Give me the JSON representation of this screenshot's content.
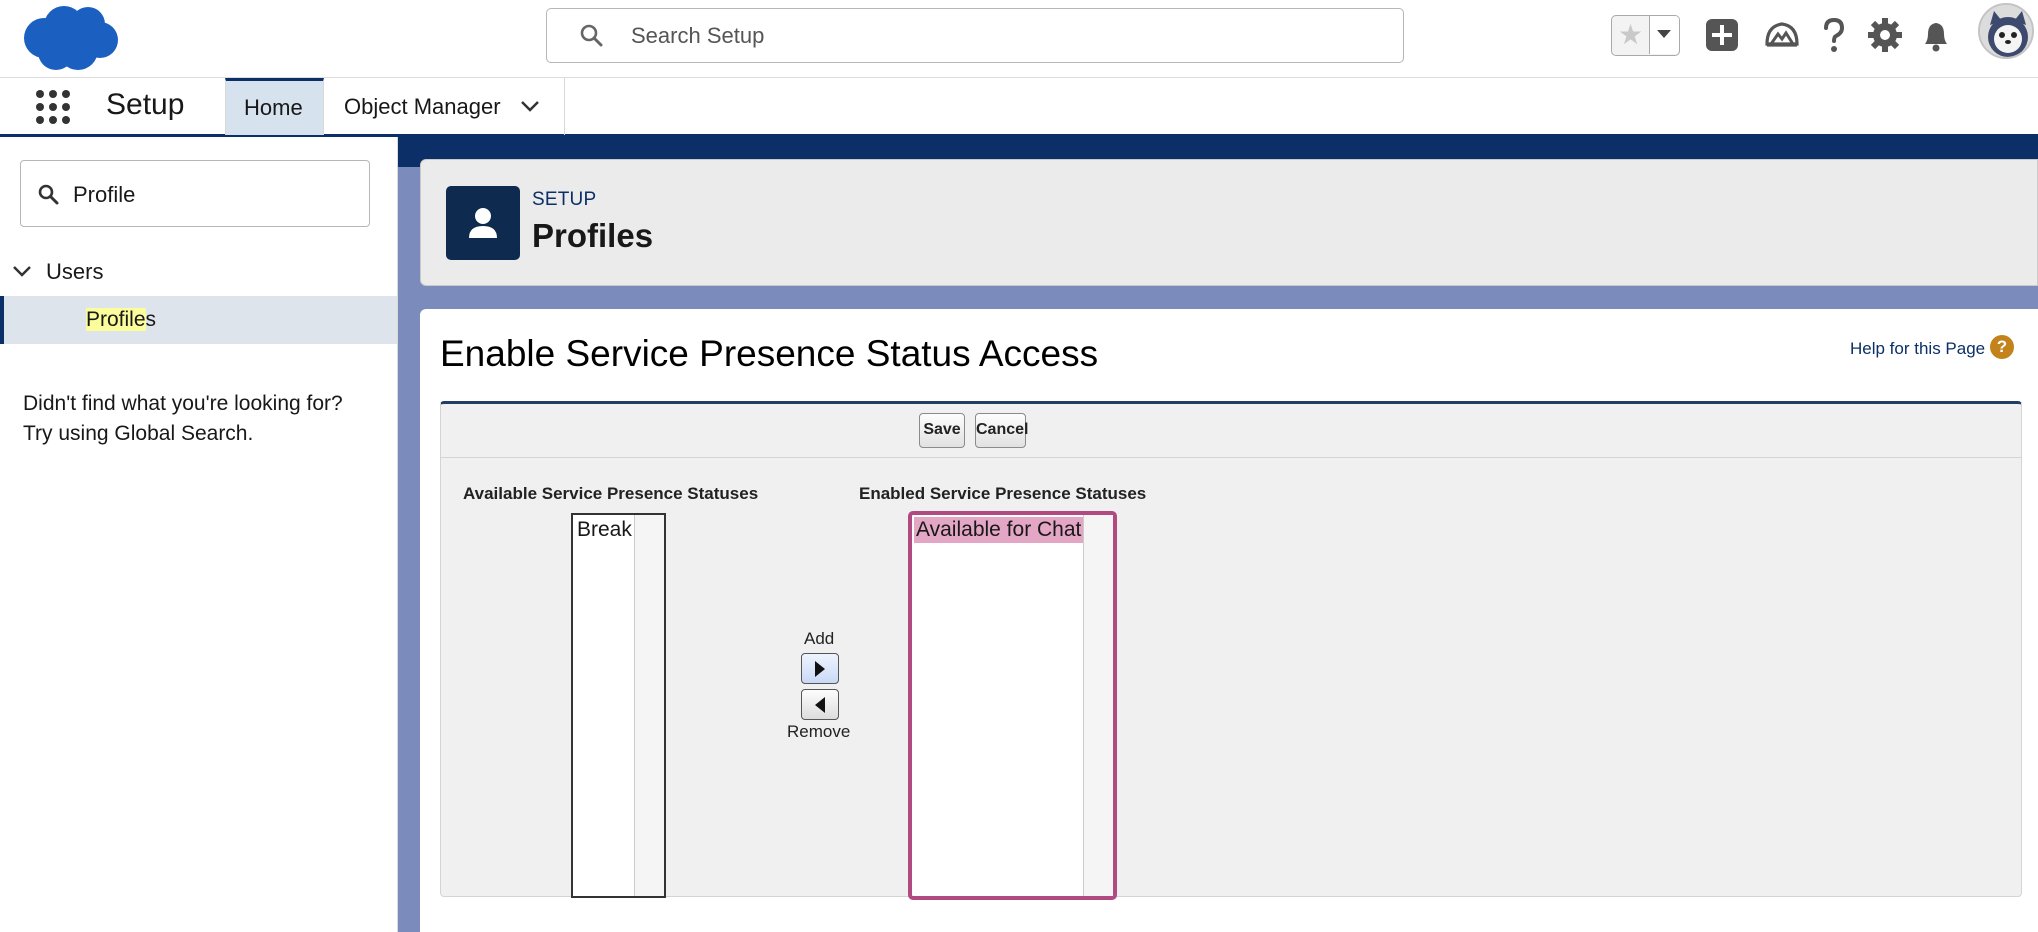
{
  "global_header": {
    "search_placeholder": "Search Setup",
    "icons": [
      "salesforce-logo",
      "search-icon",
      "favorite-star-icon",
      "chevron-down-icon",
      "global-actions-icon",
      "trailhead-icon",
      "help-icon",
      "setup-gear-icon",
      "notifications-icon",
      "avatar"
    ]
  },
  "nav": {
    "app_name": "Setup",
    "tabs": [
      {
        "label": "Home",
        "active": true
      },
      {
        "label": "Object Manager",
        "has_dropdown": true
      }
    ]
  },
  "sidebar": {
    "quick_find_value": "Profile",
    "group_label": "Users",
    "item": {
      "highlighted": "Profile",
      "rest": "s"
    },
    "not_found_line1": "Didn't find what you're looking for?",
    "not_found_line2": "Try using Global Search."
  },
  "page_header": {
    "eyebrow": "SETUP",
    "title": "Profiles"
  },
  "content": {
    "title": "Enable Service Presence Status Access",
    "help_link": "Help for this Page",
    "help_icon_glyph": "?",
    "buttons": {
      "save": "Save",
      "cancel": "Cancel"
    },
    "available_label": "Available Service Presence Statuses",
    "enabled_label": "Enabled Service Presence Statuses",
    "available_options": [
      "Break"
    ],
    "enabled_options": [
      "Available for Chat"
    ],
    "add_label": "Add",
    "remove_label": "Remove"
  },
  "colors": {
    "brand_navy": "#0b2f66",
    "logo_blue": "#1b5fc1",
    "selected_option": "#e3a6c4",
    "focus_border": "#b14a80",
    "highlight": "#fbfd9b"
  }
}
